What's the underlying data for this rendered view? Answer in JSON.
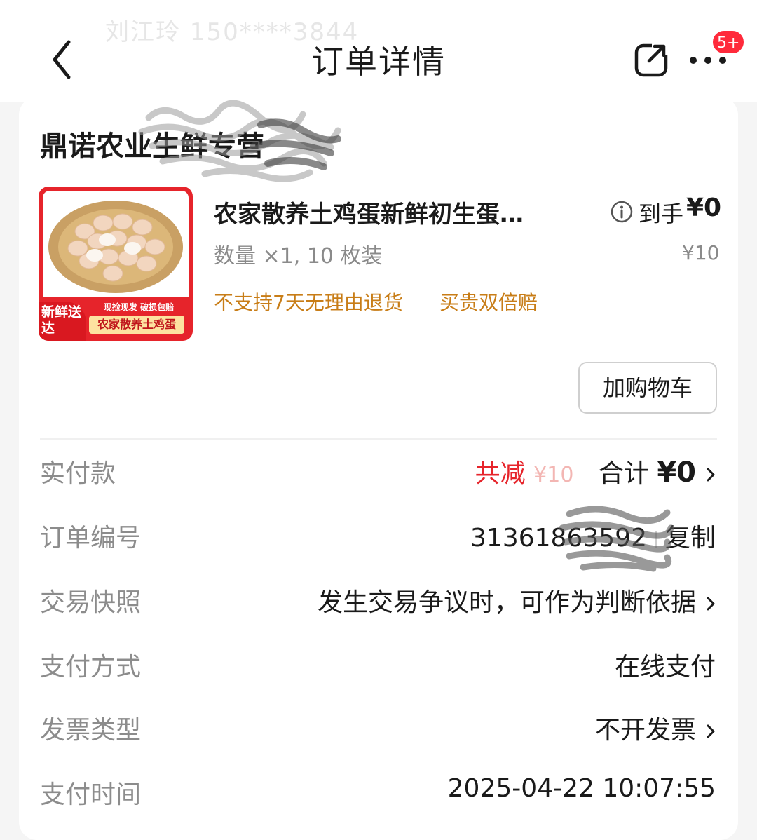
{
  "header": {
    "faded_contact": "刘江玲  150****3844",
    "title": "订单详情",
    "badge": "5+"
  },
  "shop": {
    "name": "鼎诺农业生鲜专营"
  },
  "product": {
    "image_badge": "新鲜送达",
    "image_strip_top": "现捡现发 破损包赔",
    "image_strip_label": "农家散养土鸡蛋",
    "title": "农家散养土鸡蛋新鲜初生蛋…",
    "final_price_label": "到手",
    "final_price": "¥0",
    "quantity": "数量 ×1, 10 枚装",
    "original_price": "¥10",
    "tags": [
      "不支持7天无理由退货",
      "买贵双倍赔"
    ]
  },
  "actions": {
    "add_to_cart": "加购物车"
  },
  "details": {
    "payment": {
      "label": "实付款",
      "reduced_label": "共减",
      "reduced_amount": "¥10",
      "total_label": "合计",
      "total_amount": "¥0"
    },
    "order_number": {
      "label": "订单编号",
      "value": "31361863592",
      "copy": "复制"
    },
    "snapshot": {
      "label": "交易快照",
      "value": "发生交易争议时，可作为判断依据"
    },
    "pay_method": {
      "label": "支付方式",
      "value": "在线支付"
    },
    "invoice": {
      "label": "发票类型",
      "value": "不开发票"
    },
    "pay_time": {
      "label": "支付时间",
      "value": "2025-04-22 10:07:55"
    }
  },
  "colors": {
    "accent_red": "#e6242b",
    "tag_orange": "#c87d17",
    "badge_red": "#ff2a3b"
  }
}
